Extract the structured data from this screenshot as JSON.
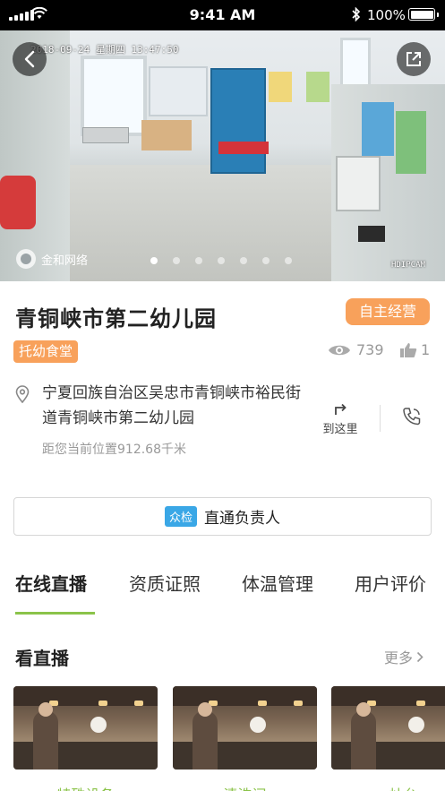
{
  "status_bar": {
    "time": "9:41 AM",
    "battery_text": "100%",
    "bluetooth_icon": "bluetooth-icon"
  },
  "hero": {
    "timestamp": "2018-09-24 星期四 13:47:50",
    "brand": "金和网络",
    "camera_tag": "HDIPCAM",
    "dots_count": 7,
    "active_dot": 0
  },
  "school": {
    "name": "青铜峡市第二幼儿园",
    "mode_badge": "自主经营",
    "tag": "托幼食堂",
    "views": "739",
    "likes": "1",
    "address": "宁夏回族自治区吴忠市青铜峡市裕民街道青铜峡市第二幼儿园",
    "distance": "距您当前位置912.68千米",
    "navigate_label": "到这里"
  },
  "contact": {
    "badge": "众检",
    "label": "直通负责人"
  },
  "tabs": [
    "在线直播",
    "资质证照",
    "体温管理",
    "用户评价"
  ],
  "active_tab": 0,
  "live": {
    "title": "看直播",
    "more": "更多",
    "items": [
      "特殊设备",
      "清洗间",
      "灶台"
    ]
  },
  "colors": {
    "accent_orange": "#f8a15b",
    "accent_green": "#8bc34a",
    "badge_blue": "#3aa7e6"
  }
}
